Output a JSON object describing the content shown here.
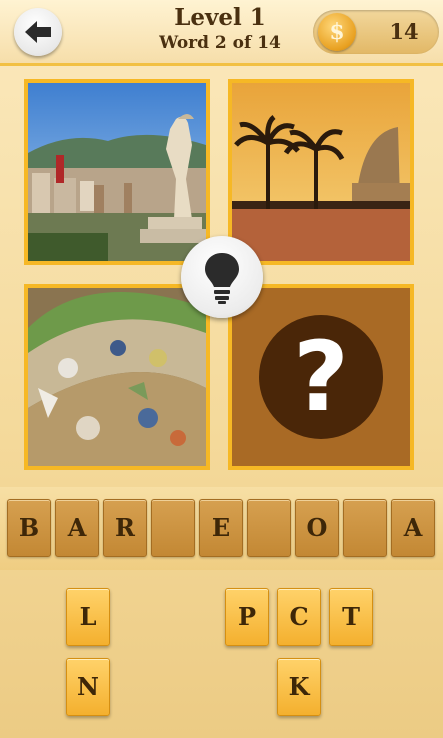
{
  "header": {
    "back_icon": "back-arrow-icon",
    "level": "Level 1",
    "word_progress": "Word 2 of 14",
    "coin_symbol": "$",
    "coins": "14"
  },
  "pictures": [
    {
      "name": "barcelona-statue-skyline"
    },
    {
      "name": "beach-palm-trees-hotel"
    },
    {
      "name": "gaudi-mosaic-bench"
    },
    {
      "name": "hidden-picture",
      "symbol": "?"
    }
  ],
  "hint": {
    "icon": "lightbulb-icon"
  },
  "answer": {
    "slots": [
      "B",
      "A",
      "R",
      "",
      "E",
      "",
      "O",
      "",
      "A"
    ]
  },
  "letters": {
    "row1": [
      "L",
      "",
      "",
      "",
      "P",
      "C",
      "T"
    ],
    "row2": [
      "N",
      "",
      "",
      "",
      "",
      "K",
      ""
    ]
  },
  "colors": {
    "accent": "#f6b825",
    "tile_brown": "#c38834",
    "key_yellow": "#f4b02e",
    "text_dark": "#4a3010"
  }
}
